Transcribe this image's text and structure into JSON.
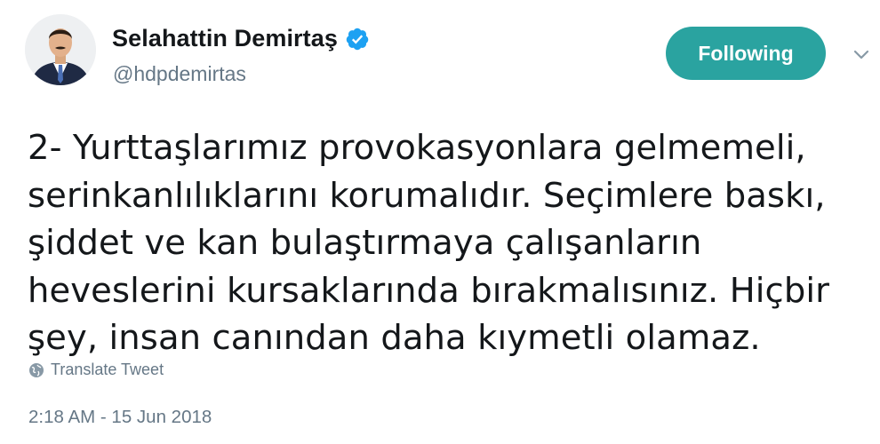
{
  "user": {
    "display_name": "Selahattin Demirtaş",
    "handle": "@hdpdemirtas",
    "verified": true
  },
  "follow_button": {
    "label": "Following"
  },
  "tweet": {
    "text": "2- Yurttaşlarımız provokasyonlara gelmemeli,\nserinkanlılıklarını korumalıdır. Seçimlere baskı,\nşiddet ve kan bulaştırmaya çalışanların\nheveslerini kursaklarında bırakmalısınız. Hiçbir\nşey, insan canından daha kıymetli olamaz.",
    "translate_label": "Translate Tweet",
    "timestamp": "2:18 AM - 15 Jun 2018"
  },
  "colors": {
    "follow_button_bg": "#2aa3a0",
    "verified_badge": "#1da1f2",
    "secondary_text": "#657786"
  },
  "icons": {
    "verified": "verified-badge-icon",
    "caret": "chevron-down-icon",
    "translate": "globe-icon"
  }
}
